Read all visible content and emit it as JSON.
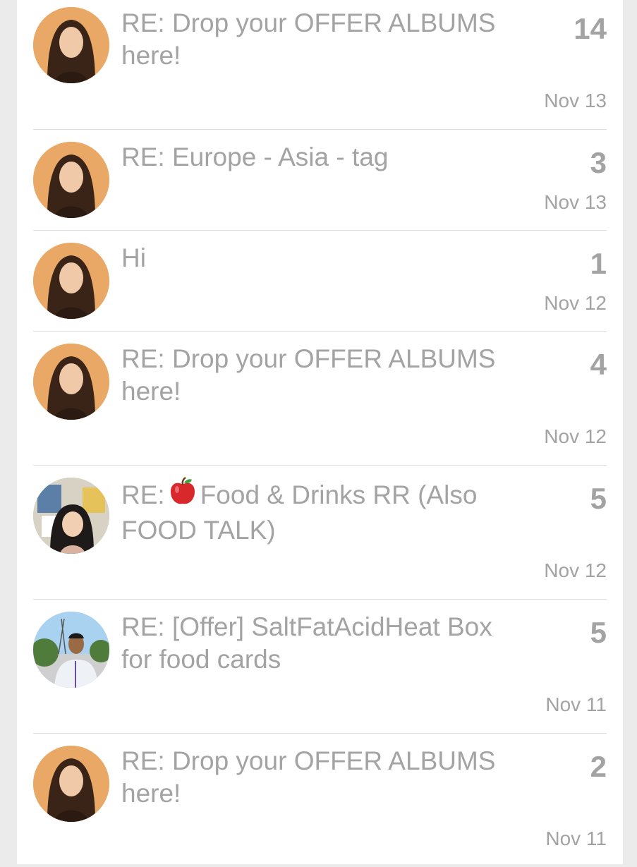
{
  "messages": [
    {
      "subject": "RE: Drop your OFFER ALBUMS here!",
      "count": "14",
      "date": "Nov 13",
      "avatar": "woman-portrait"
    },
    {
      "subject": "RE: Europe - Asia - tag",
      "count": "3",
      "date": "Nov 13",
      "avatar": "woman-portrait"
    },
    {
      "subject": "Hi",
      "count": "1",
      "date": "Nov 12",
      "avatar": "woman-portrait"
    },
    {
      "subject": "RE: Drop your OFFER ALBUMS here!",
      "count": "4",
      "date": "Nov 12",
      "avatar": "woman-portrait"
    },
    {
      "subject_prefix": "RE:",
      "subject_emoji": "apple-emoji",
      "subject": "Food & Drinks RR (Also FOOD TALK)",
      "count": "5",
      "date": "Nov 12",
      "avatar": "child-portrait"
    },
    {
      "subject": "RE: [Offer] SaltFatAcidHeat Box for food cards",
      "count": "5",
      "date": "Nov 11",
      "avatar": "man-portrait"
    },
    {
      "subject": "RE: Drop your OFFER ALBUMS here!",
      "count": "2",
      "date": "Nov 11",
      "avatar": "woman-portrait"
    }
  ]
}
